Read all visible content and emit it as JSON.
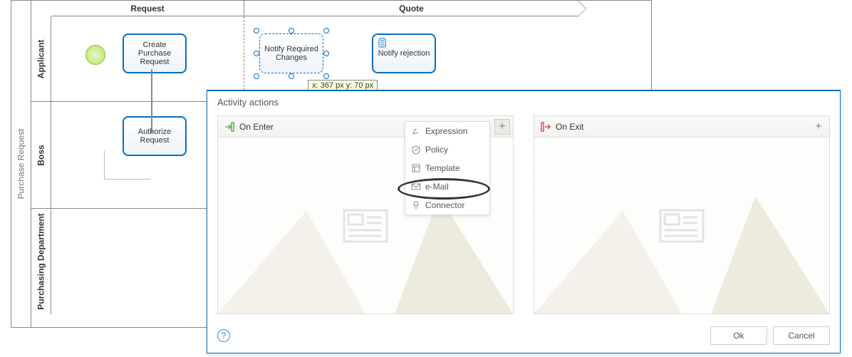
{
  "pool": {
    "label": "Purchase Request"
  },
  "lanes": {
    "applicant": {
      "label": "Applicant"
    },
    "boss": {
      "label": "Boss"
    },
    "purchasing": {
      "label": "Purchasing Department"
    }
  },
  "phases": {
    "request": "Request",
    "quote": "Quote"
  },
  "tasks": {
    "create": "Create Purchase Request",
    "notify_changes": "Notify Required Changes",
    "notify_rejection": "Notify rejection",
    "authorize": "Authorize Request"
  },
  "tooltip": "x: 367 px  y: 70 px",
  "dialog": {
    "title": "Activity actions",
    "on_enter": "On Enter",
    "on_exit": "On Exit",
    "menu": {
      "expression": "Expression",
      "policy": "Policy",
      "template": "Template",
      "email": "e-Mail",
      "connector": "Connector"
    },
    "ok": "Ok",
    "cancel": "Cancel"
  }
}
